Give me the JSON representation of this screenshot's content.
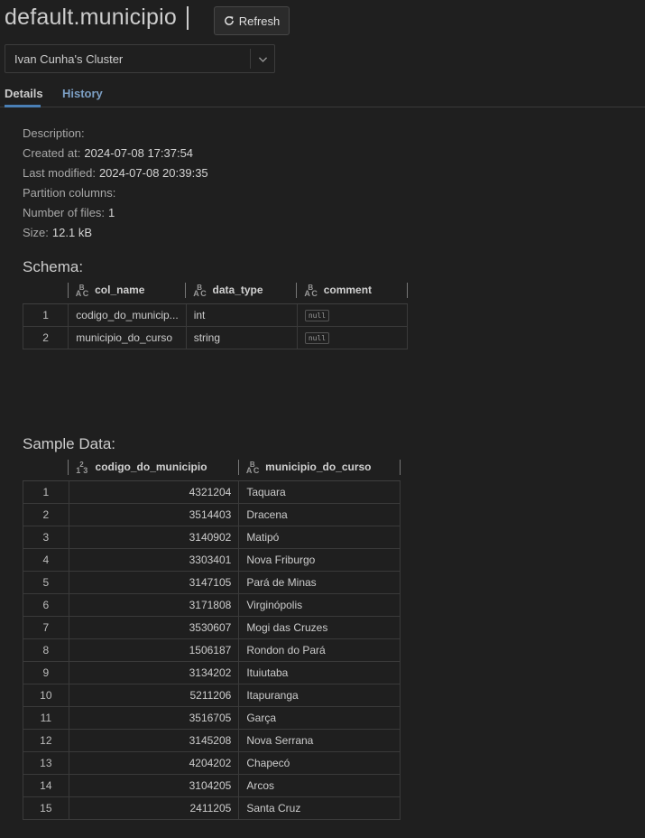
{
  "header": {
    "title": "default.municipio",
    "refresh_label": "Refresh",
    "refresh_icon": "refresh-icon"
  },
  "cluster_select": {
    "value": "Ivan Cunha's Cluster",
    "icon": "chevron-down-icon"
  },
  "tabs": [
    {
      "label": "Details",
      "active": true
    },
    {
      "label": "History",
      "active": false
    }
  ],
  "details": {
    "description_label": "Description:",
    "description_value": "",
    "created_label": "Created at:",
    "created_value": "2024-07-08 17:37:54",
    "modified_label": "Last modified:",
    "modified_value": "2024-07-08 20:39:35",
    "partition_label": "Partition columns:",
    "partition_value": "",
    "files_label": "Number of files:",
    "files_value": "1",
    "size_label": "Size:",
    "size_value": "12.1 kB"
  },
  "schema": {
    "title": "Schema:",
    "columns": [
      {
        "label": "col_name",
        "type_icon": "abc-type-icon"
      },
      {
        "label": "data_type",
        "type_icon": "abc-type-icon"
      },
      {
        "label": "comment",
        "type_icon": "abc-type-icon"
      }
    ],
    "rows": [
      {
        "n": "1",
        "col_name": "codigo_do_municip...",
        "data_type": "int",
        "comment": "null"
      },
      {
        "n": "2",
        "col_name": "municipio_do_curso",
        "data_type": "string",
        "comment": "null"
      }
    ]
  },
  "sample": {
    "title": "Sample Data:",
    "columns": [
      {
        "label": "codigo_do_municipio",
        "type_icon": "numeric-type-icon"
      },
      {
        "label": "municipio_do_curso",
        "type_icon": "abc-type-icon"
      }
    ],
    "rows": [
      {
        "n": "1",
        "codigo": "4321204",
        "municipio": "Taquara"
      },
      {
        "n": "2",
        "codigo": "3514403",
        "municipio": "Dracena"
      },
      {
        "n": "3",
        "codigo": "3140902",
        "municipio": "Matipó"
      },
      {
        "n": "4",
        "codigo": "3303401",
        "municipio": "Nova Friburgo"
      },
      {
        "n": "5",
        "codigo": "3147105",
        "municipio": "Pará de Minas"
      },
      {
        "n": "6",
        "codigo": "3171808",
        "municipio": "Virginópolis"
      },
      {
        "n": "7",
        "codigo": "3530607",
        "municipio": "Mogi das Cruzes"
      },
      {
        "n": "8",
        "codigo": "1506187",
        "municipio": "Rondon do Pará"
      },
      {
        "n": "9",
        "codigo": "3134202",
        "municipio": "Ituiutaba"
      },
      {
        "n": "10",
        "codigo": "5211206",
        "municipio": "Itapuranga"
      },
      {
        "n": "11",
        "codigo": "3516705",
        "municipio": "Garça"
      },
      {
        "n": "12",
        "codigo": "3145208",
        "municipio": "Nova Serrana"
      },
      {
        "n": "13",
        "codigo": "4204202",
        "municipio": "Chapecó"
      },
      {
        "n": "14",
        "codigo": "3104205",
        "municipio": "Arcos"
      },
      {
        "n": "15",
        "codigo": "2411205",
        "municipio": "Santa Cruz"
      }
    ]
  },
  "colors": {
    "background": "#1f1f1f",
    "tab_active_underline": "#4a7fb5",
    "tab_inactive": "#7c9fc4"
  }
}
